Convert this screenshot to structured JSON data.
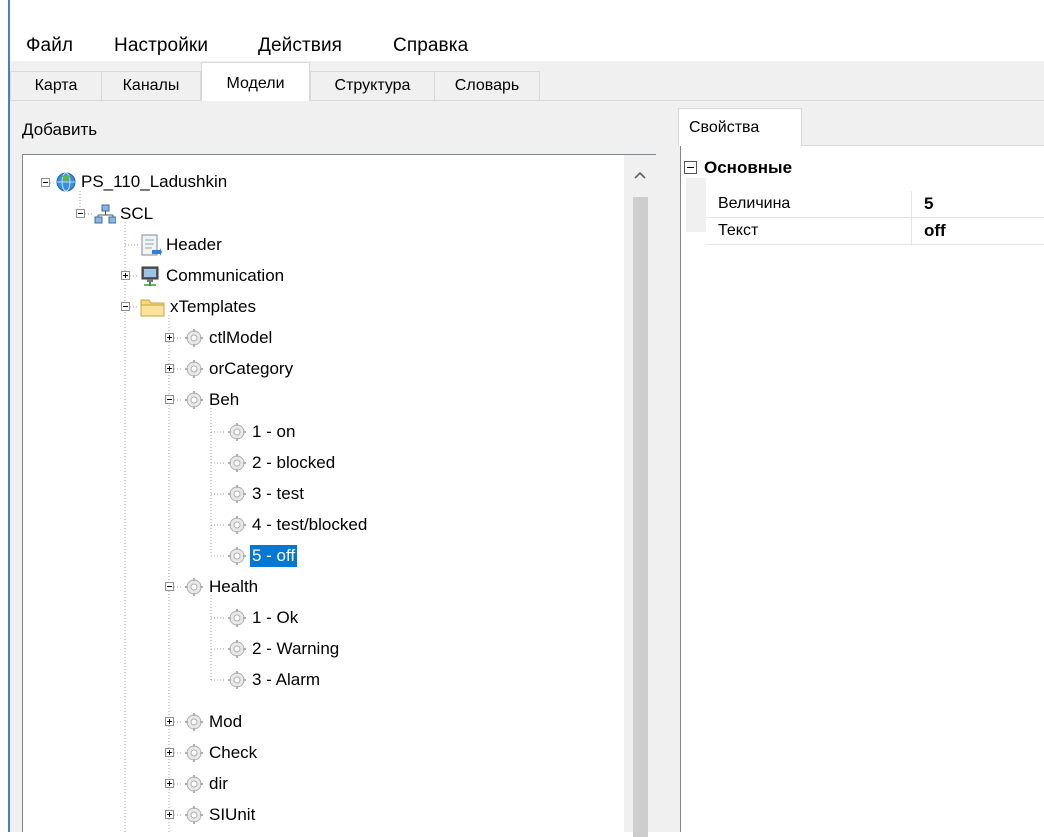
{
  "menu": {
    "items": [
      "Файл",
      "Настройки",
      "Действия",
      "Справка"
    ]
  },
  "tabs": {
    "items": [
      "Карта",
      "Каналы",
      "Модели",
      "Структура",
      "Словарь"
    ],
    "active": "Модели"
  },
  "left_pane": {
    "add_label": "Добавить"
  },
  "tree": {
    "nodes": [
      {
        "label": "PS_110_Ladushkin",
        "icon": "globe-icon"
      },
      {
        "label": "SCL",
        "icon": "network-icon"
      },
      {
        "label": "Header",
        "icon": "document-icon"
      },
      {
        "label": "Communication",
        "icon": "computer-icon"
      },
      {
        "label": "xTemplates",
        "icon": "folder-icon"
      },
      {
        "label": "ctlModel",
        "icon": "gear-icon"
      },
      {
        "label": "orCategory",
        "icon": "gear-icon"
      },
      {
        "label": "Beh",
        "icon": "gear-icon"
      },
      {
        "label": "1 - on",
        "icon": "gear-icon"
      },
      {
        "label": "2 - blocked",
        "icon": "gear-icon"
      },
      {
        "label": "3 - test",
        "icon": "gear-icon"
      },
      {
        "label": "4 - test/blocked",
        "icon": "gear-icon"
      },
      {
        "label": "5 - off",
        "icon": "gear-icon",
        "selected": true
      },
      {
        "label": "Health",
        "icon": "gear-icon"
      },
      {
        "label": "1 - Ok",
        "icon": "gear-icon"
      },
      {
        "label": "2 - Warning",
        "icon": "gear-icon"
      },
      {
        "label": "3 - Alarm",
        "icon": "gear-icon"
      },
      {
        "label": "Mod",
        "icon": "gear-icon"
      },
      {
        "label": "Check",
        "icon": "gear-icon"
      },
      {
        "label": "dir",
        "icon": "gear-icon"
      },
      {
        "label": "SIUnit",
        "icon": "gear-icon"
      }
    ]
  },
  "properties": {
    "tab_label": "Свойства",
    "category": "Основные",
    "rows": [
      {
        "name": "Величина",
        "value": "5"
      },
      {
        "name": "Текст",
        "value": "off"
      }
    ]
  },
  "colors": {
    "selection": "#0078d7",
    "window_bg": "#f0f0f0",
    "accent_edge": "#4a7fc6"
  }
}
